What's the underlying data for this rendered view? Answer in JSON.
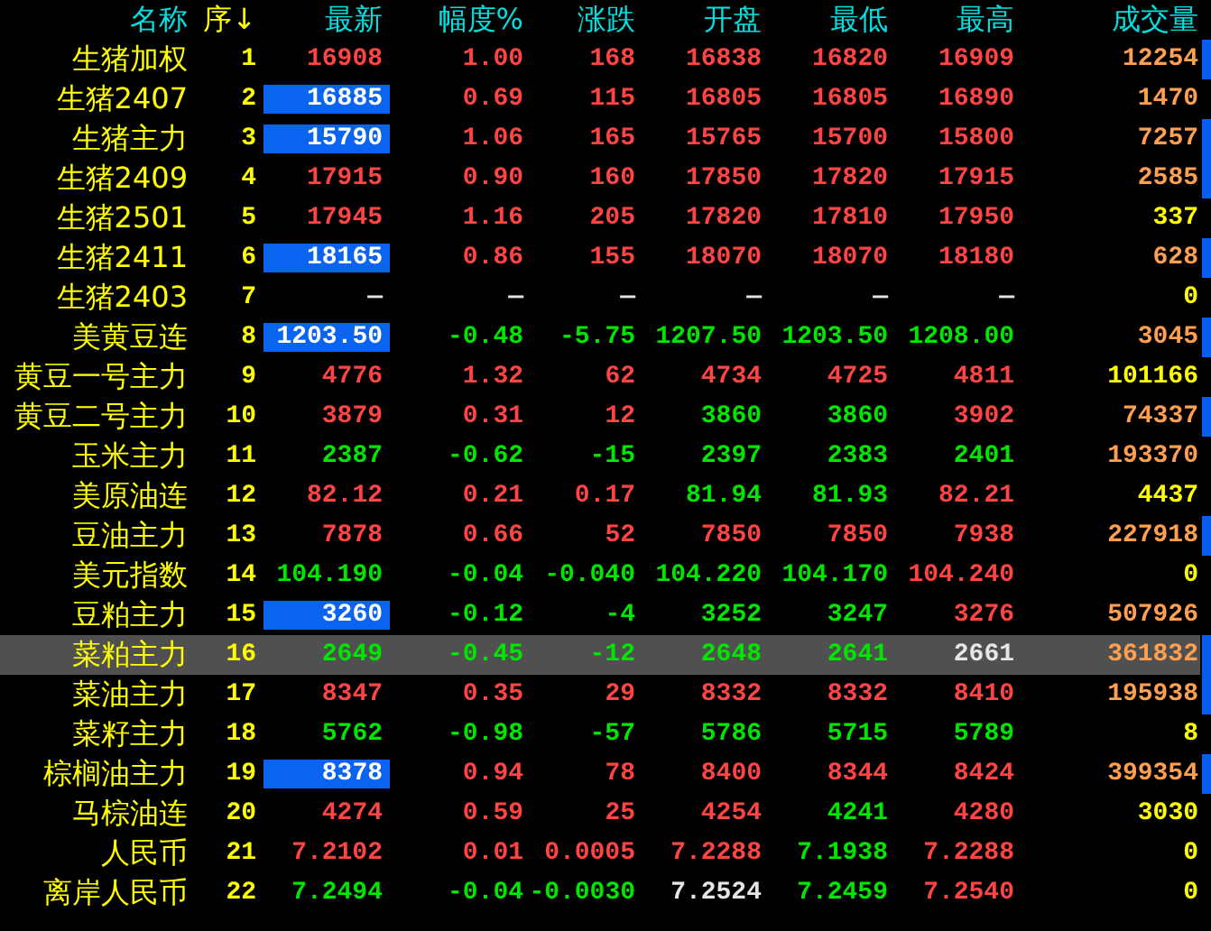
{
  "table": {
    "columns": [
      {
        "label": "名称",
        "color": "#00e0e0"
      },
      {
        "label": "序↓",
        "color": "#ffff00"
      },
      {
        "label": "最新",
        "color": "#00e0e0"
      },
      {
        "label": "幅度%",
        "color": "#00e0e0"
      },
      {
        "label": "涨跌",
        "color": "#00e0e0"
      },
      {
        "label": "开盘",
        "color": "#00e0e0"
      },
      {
        "label": "最低",
        "color": "#00e0e0"
      },
      {
        "label": "最高",
        "color": "#00e0e0"
      },
      {
        "label": "成交量",
        "color": "#00e0e0"
      }
    ],
    "rows": [
      {
        "selected": false,
        "latest_highlighted": false,
        "flag": true,
        "cells": [
          {
            "text": "生猪加权"
          },
          {
            "text": "1",
            "color": "#ffff00"
          },
          {
            "text": "16908",
            "color": "#ff4444"
          },
          {
            "text": "1.00",
            "color": "#ff4444"
          },
          {
            "text": "168",
            "color": "#ff4444"
          },
          {
            "text": "16838",
            "color": "#ff4444"
          },
          {
            "text": "16820",
            "color": "#ff4444"
          },
          {
            "text": "16909",
            "color": "#ff4444"
          },
          {
            "text": "12254",
            "color": "#ff9f50"
          }
        ]
      },
      {
        "selected": false,
        "latest_highlighted": true,
        "flag": false,
        "cells": [
          {
            "text": "生猪2407"
          },
          {
            "text": "2",
            "color": "#ffff00"
          },
          {
            "text": "16885"
          },
          {
            "text": "0.69",
            "color": "#ff4444"
          },
          {
            "text": "115",
            "color": "#ff4444"
          },
          {
            "text": "16805",
            "color": "#ff4444"
          },
          {
            "text": "16805",
            "color": "#ff4444"
          },
          {
            "text": "16890",
            "color": "#ff4444"
          },
          {
            "text": "1470",
            "color": "#ff9f50"
          }
        ]
      },
      {
        "selected": false,
        "latest_highlighted": true,
        "flag": true,
        "cells": [
          {
            "text": "生猪主力"
          },
          {
            "text": "3",
            "color": "#ffff00"
          },
          {
            "text": "15790"
          },
          {
            "text": "1.06",
            "color": "#ff4444"
          },
          {
            "text": "165",
            "color": "#ff4444"
          },
          {
            "text": "15765",
            "color": "#ff4444"
          },
          {
            "text": "15700",
            "color": "#ff4444"
          },
          {
            "text": "15800",
            "color": "#ff4444"
          },
          {
            "text": "7257",
            "color": "#ff9f50"
          }
        ]
      },
      {
        "selected": false,
        "latest_highlighted": false,
        "flag": true,
        "cells": [
          {
            "text": "生猪2409"
          },
          {
            "text": "4",
            "color": "#ffff00"
          },
          {
            "text": "17915",
            "color": "#ff4444"
          },
          {
            "text": "0.90",
            "color": "#ff4444"
          },
          {
            "text": "160",
            "color": "#ff4444"
          },
          {
            "text": "17850",
            "color": "#ff4444"
          },
          {
            "text": "17820",
            "color": "#ff4444"
          },
          {
            "text": "17915",
            "color": "#ff4444"
          },
          {
            "text": "2585",
            "color": "#ff9f50"
          }
        ]
      },
      {
        "selected": false,
        "latest_highlighted": false,
        "flag": false,
        "cells": [
          {
            "text": "生猪2501"
          },
          {
            "text": "5",
            "color": "#ffff00"
          },
          {
            "text": "17945",
            "color": "#ff4444"
          },
          {
            "text": "1.16",
            "color": "#ff4444"
          },
          {
            "text": "205",
            "color": "#ff4444"
          },
          {
            "text": "17820",
            "color": "#ff4444"
          },
          {
            "text": "17810",
            "color": "#ff4444"
          },
          {
            "text": "17950",
            "color": "#ff4444"
          },
          {
            "text": "337",
            "color": "#ffff00"
          }
        ]
      },
      {
        "selected": false,
        "latest_highlighted": true,
        "flag": true,
        "cells": [
          {
            "text": "生猪2411"
          },
          {
            "text": "6",
            "color": "#ffff00"
          },
          {
            "text": "18165"
          },
          {
            "text": "0.86",
            "color": "#ff4444"
          },
          {
            "text": "155",
            "color": "#ff4444"
          },
          {
            "text": "18070",
            "color": "#ff4444"
          },
          {
            "text": "18070",
            "color": "#ff4444"
          },
          {
            "text": "18180",
            "color": "#ff4444"
          },
          {
            "text": "628",
            "color": "#ff9f50"
          }
        ]
      },
      {
        "selected": false,
        "latest_highlighted": false,
        "flag": false,
        "cells": [
          {
            "text": "生猪2403"
          },
          {
            "text": "7",
            "color": "#ffff00"
          },
          {
            "text": "—",
            "color": "#e6e6e6"
          },
          {
            "text": "—",
            "color": "#e6e6e6"
          },
          {
            "text": "—",
            "color": "#e6e6e6"
          },
          {
            "text": "—",
            "color": "#e6e6e6"
          },
          {
            "text": "—",
            "color": "#e6e6e6"
          },
          {
            "text": "—",
            "color": "#e6e6e6"
          },
          {
            "text": "0",
            "color": "#ffff00"
          }
        ]
      },
      {
        "selected": false,
        "latest_highlighted": true,
        "flag": true,
        "cells": [
          {
            "text": "美黄豆连"
          },
          {
            "text": "8",
            "color": "#ffff00"
          },
          {
            "text": "1203.50"
          },
          {
            "text": "-0.48",
            "color": "#00e600"
          },
          {
            "text": "-5.75",
            "color": "#00e600"
          },
          {
            "text": "1207.50",
            "color": "#00e600"
          },
          {
            "text": "1203.50",
            "color": "#00e600"
          },
          {
            "text": "1208.00",
            "color": "#00e600"
          },
          {
            "text": "3045",
            "color": "#ff9f50"
          }
        ]
      },
      {
        "selected": false,
        "latest_highlighted": false,
        "flag": false,
        "cells": [
          {
            "text": "黄豆一号主力"
          },
          {
            "text": "9",
            "color": "#ffff00"
          },
          {
            "text": "4776",
            "color": "#ff4444"
          },
          {
            "text": "1.32",
            "color": "#ff4444"
          },
          {
            "text": "62",
            "color": "#ff4444"
          },
          {
            "text": "4734",
            "color": "#ff4444"
          },
          {
            "text": "4725",
            "color": "#ff4444"
          },
          {
            "text": "4811",
            "color": "#ff4444"
          },
          {
            "text": "101166",
            "color": "#ffff00"
          }
        ]
      },
      {
        "selected": false,
        "latest_highlighted": false,
        "flag": true,
        "cells": [
          {
            "text": "黄豆二号主力"
          },
          {
            "text": "10",
            "color": "#ffff00"
          },
          {
            "text": "3879",
            "color": "#ff4444"
          },
          {
            "text": "0.31",
            "color": "#ff4444"
          },
          {
            "text": "12",
            "color": "#ff4444"
          },
          {
            "text": "3860",
            "color": "#00e600"
          },
          {
            "text": "3860",
            "color": "#00e600"
          },
          {
            "text": "3902",
            "color": "#ff4444"
          },
          {
            "text": "74337",
            "color": "#ff9f50"
          }
        ]
      },
      {
        "selected": false,
        "latest_highlighted": false,
        "flag": false,
        "cells": [
          {
            "text": "玉米主力"
          },
          {
            "text": "11",
            "color": "#ffff00"
          },
          {
            "text": "2387",
            "color": "#00e600"
          },
          {
            "text": "-0.62",
            "color": "#00e600"
          },
          {
            "text": "-15",
            "color": "#00e600"
          },
          {
            "text": "2397",
            "color": "#00e600"
          },
          {
            "text": "2383",
            "color": "#00e600"
          },
          {
            "text": "2401",
            "color": "#00e600"
          },
          {
            "text": "193370",
            "color": "#ff9f50"
          }
        ]
      },
      {
        "selected": false,
        "latest_highlighted": false,
        "flag": false,
        "cells": [
          {
            "text": "美原油连"
          },
          {
            "text": "12",
            "color": "#ffff00"
          },
          {
            "text": "82.12",
            "color": "#ff4444"
          },
          {
            "text": "0.21",
            "color": "#ff4444"
          },
          {
            "text": "0.17",
            "color": "#ff4444"
          },
          {
            "text": "81.94",
            "color": "#00e600"
          },
          {
            "text": "81.93",
            "color": "#00e600"
          },
          {
            "text": "82.21",
            "color": "#ff4444"
          },
          {
            "text": "4437",
            "color": "#ffff00"
          }
        ]
      },
      {
        "selected": false,
        "latest_highlighted": false,
        "flag": true,
        "cells": [
          {
            "text": "豆油主力"
          },
          {
            "text": "13",
            "color": "#ffff00"
          },
          {
            "text": "7878",
            "color": "#ff4444"
          },
          {
            "text": "0.66",
            "color": "#ff4444"
          },
          {
            "text": "52",
            "color": "#ff4444"
          },
          {
            "text": "7850",
            "color": "#ff4444"
          },
          {
            "text": "7850",
            "color": "#ff4444"
          },
          {
            "text": "7938",
            "color": "#ff4444"
          },
          {
            "text": "227918",
            "color": "#ff9f50"
          }
        ]
      },
      {
        "selected": false,
        "latest_highlighted": false,
        "flag": false,
        "cells": [
          {
            "text": "美元指数"
          },
          {
            "text": "14",
            "color": "#ffff00"
          },
          {
            "text": "104.190",
            "color": "#00e600"
          },
          {
            "text": "-0.04",
            "color": "#00e600"
          },
          {
            "text": "-0.040",
            "color": "#00e600"
          },
          {
            "text": "104.220",
            "color": "#00e600"
          },
          {
            "text": "104.170",
            "color": "#00e600"
          },
          {
            "text": "104.240",
            "color": "#ff4444"
          },
          {
            "text": "0",
            "color": "#ffff00"
          }
        ]
      },
      {
        "selected": false,
        "latest_highlighted": true,
        "flag": false,
        "cells": [
          {
            "text": "豆粕主力"
          },
          {
            "text": "15",
            "color": "#ffff00"
          },
          {
            "text": "3260"
          },
          {
            "text": "-0.12",
            "color": "#00e600"
          },
          {
            "text": "-4",
            "color": "#00e600"
          },
          {
            "text": "3252",
            "color": "#00e600"
          },
          {
            "text": "3247",
            "color": "#00e600"
          },
          {
            "text": "3276",
            "color": "#ff4444"
          },
          {
            "text": "507926",
            "color": "#ff9f50"
          }
        ]
      },
      {
        "selected": true,
        "latest_highlighted": false,
        "flag": true,
        "cells": [
          {
            "text": "菜粕主力"
          },
          {
            "text": "16",
            "color": "#ffff00"
          },
          {
            "text": "2649",
            "color": "#00e600"
          },
          {
            "text": "-0.45",
            "color": "#00e600"
          },
          {
            "text": "-12",
            "color": "#00e600"
          },
          {
            "text": "2648",
            "color": "#00e600"
          },
          {
            "text": "2641",
            "color": "#00e600"
          },
          {
            "text": "2661",
            "color": "#e6e6e6"
          },
          {
            "text": "361832",
            "color": "#ff9f50"
          }
        ]
      },
      {
        "selected": false,
        "latest_highlighted": false,
        "flag": true,
        "cells": [
          {
            "text": "菜油主力"
          },
          {
            "text": "17",
            "color": "#ffff00"
          },
          {
            "text": "8347",
            "color": "#ff4444"
          },
          {
            "text": "0.35",
            "color": "#ff4444"
          },
          {
            "text": "29",
            "color": "#ff4444"
          },
          {
            "text": "8332",
            "color": "#ff4444"
          },
          {
            "text": "8332",
            "color": "#ff4444"
          },
          {
            "text": "8410",
            "color": "#ff4444"
          },
          {
            "text": "195938",
            "color": "#ff9f50"
          }
        ]
      },
      {
        "selected": false,
        "latest_highlighted": false,
        "flag": false,
        "cells": [
          {
            "text": "菜籽主力"
          },
          {
            "text": "18",
            "color": "#ffff00"
          },
          {
            "text": "5762",
            "color": "#00e600"
          },
          {
            "text": "-0.98",
            "color": "#00e600"
          },
          {
            "text": "-57",
            "color": "#00e600"
          },
          {
            "text": "5786",
            "color": "#00e600"
          },
          {
            "text": "5715",
            "color": "#00e600"
          },
          {
            "text": "5789",
            "color": "#00e600"
          },
          {
            "text": "8",
            "color": "#ffff00"
          }
        ]
      },
      {
        "selected": false,
        "latest_highlighted": true,
        "flag": true,
        "cells": [
          {
            "text": "棕榈油主力"
          },
          {
            "text": "19",
            "color": "#ffff00"
          },
          {
            "text": "8378"
          },
          {
            "text": "0.94",
            "color": "#ff4444"
          },
          {
            "text": "78",
            "color": "#ff4444"
          },
          {
            "text": "8400",
            "color": "#ff4444"
          },
          {
            "text": "8344",
            "color": "#ff4444"
          },
          {
            "text": "8424",
            "color": "#ff4444"
          },
          {
            "text": "399354",
            "color": "#ff9f50"
          }
        ]
      },
      {
        "selected": false,
        "latest_highlighted": false,
        "flag": false,
        "cells": [
          {
            "text": "马棕油连"
          },
          {
            "text": "20",
            "color": "#ffff00"
          },
          {
            "text": "4274",
            "color": "#ff4444"
          },
          {
            "text": "0.59",
            "color": "#ff4444"
          },
          {
            "text": "25",
            "color": "#ff4444"
          },
          {
            "text": "4254",
            "color": "#ff4444"
          },
          {
            "text": "4241",
            "color": "#00e600"
          },
          {
            "text": "4280",
            "color": "#ff4444"
          },
          {
            "text": "3030",
            "color": "#ffff00"
          }
        ]
      },
      {
        "selected": false,
        "latest_highlighted": false,
        "flag": false,
        "cells": [
          {
            "text": "人民币"
          },
          {
            "text": "21",
            "color": "#ffff00"
          },
          {
            "text": "7.2102",
            "color": "#ff4444"
          },
          {
            "text": "0.01",
            "color": "#ff4444"
          },
          {
            "text": "0.0005",
            "color": "#ff4444"
          },
          {
            "text": "7.2288",
            "color": "#ff4444"
          },
          {
            "text": "7.1938",
            "color": "#00e600"
          },
          {
            "text": "7.2288",
            "color": "#ff4444"
          },
          {
            "text": "0",
            "color": "#ffff00"
          }
        ]
      },
      {
        "selected": false,
        "latest_highlighted": false,
        "flag": false,
        "cells": [
          {
            "text": "离岸人民币"
          },
          {
            "text": "22",
            "color": "#ffff00"
          },
          {
            "text": "7.2494",
            "color": "#00e600"
          },
          {
            "text": "-0.04",
            "color": "#00e600"
          },
          {
            "text": "-0.0030",
            "color": "#00e600"
          },
          {
            "text": "7.2524",
            "color": "#e6e6e6"
          },
          {
            "text": "7.2459",
            "color": "#00e600"
          },
          {
            "text": "7.2540",
            "color": "#ff4444"
          },
          {
            "text": "0",
            "color": "#ffff00"
          }
        ]
      }
    ]
  }
}
